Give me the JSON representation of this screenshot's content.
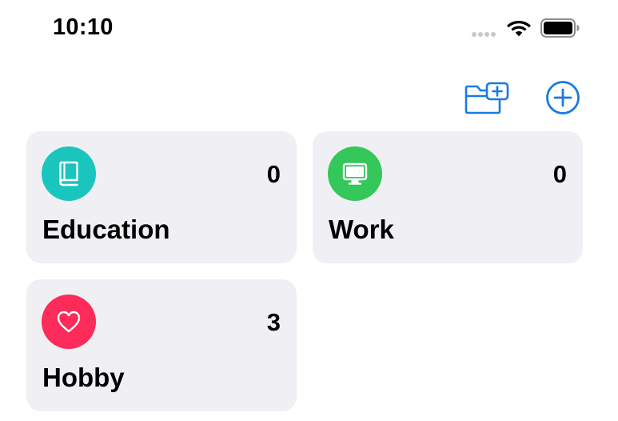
{
  "status_bar": {
    "time": "10:10",
    "icons": [
      "signal-dots-icon",
      "wifi-icon",
      "battery-icon"
    ]
  },
  "toolbar": {
    "buttons": [
      "new-folder-icon",
      "add-circle-icon"
    ],
    "accent_color": "#1a7ae3"
  },
  "categories": [
    {
      "title": "Education",
      "count": "0",
      "icon": "book-icon",
      "color": "#1ac5bd"
    },
    {
      "title": "Work",
      "count": "0",
      "icon": "desktop-icon",
      "color": "#34c759"
    },
    {
      "title": "Hobby",
      "count": "3",
      "icon": "heart-icon",
      "color": "#fc2b59"
    }
  ]
}
